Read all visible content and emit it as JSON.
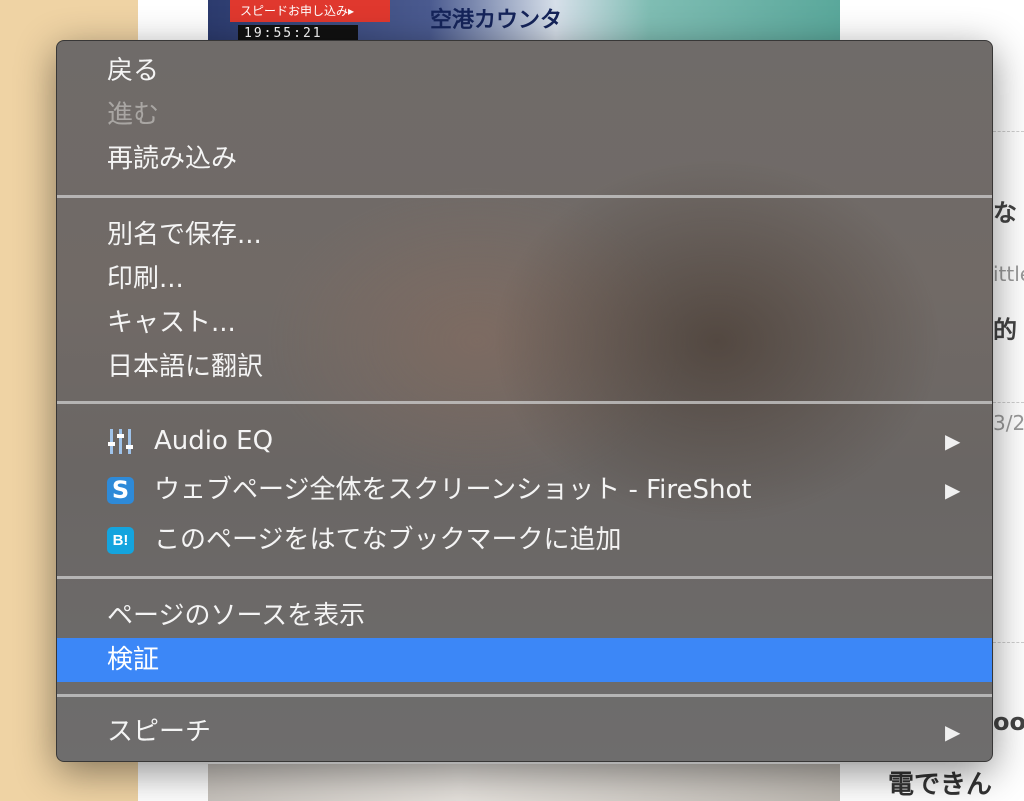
{
  "background": {
    "banner_promo": "スピードお申し込み▸",
    "banner_clock": "19:55:21",
    "banner_title": "空港カウンタ",
    "side_fragments": [
      "な",
      "ittle",
      "的",
      "3/2",
      "oo"
    ],
    "bottom_text": "電できん"
  },
  "menu": {
    "back": "戻る",
    "forward": "進む",
    "reload": "再読み込み",
    "save_as": "別名で保存...",
    "print": "印刷...",
    "cast": "キャスト...",
    "translate": "日本語に翻訳",
    "audio_eq": "Audio EQ",
    "fireshot": "ウェブページ全体をスクリーンショット - FireShot",
    "hatena": "このページをはてなブックマークに追加",
    "view_source": "ページのソースを表示",
    "inspect": "検証",
    "speech": "スピーチ",
    "submenu_arrow": "▶",
    "fireshot_icon_glyph": "S",
    "hatena_icon_glyph": "B!"
  },
  "colors": {
    "selected": "#3c87f7",
    "fireshot_icon": "#2e8ad8",
    "hatena_icon": "#14a4de",
    "audio_eq_icon": "#9fc3ea"
  },
  "icons": [
    "equalizer-icon",
    "fireshot-icon",
    "hatena-bookmark-icon",
    "chevron-right-icon"
  ]
}
